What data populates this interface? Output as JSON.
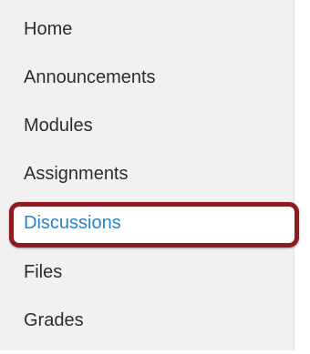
{
  "course_nav": {
    "items": [
      {
        "label": "Home",
        "active": false
      },
      {
        "label": "Announcements",
        "active": false
      },
      {
        "label": "Modules",
        "active": false
      },
      {
        "label": "Assignments",
        "active": false
      },
      {
        "label": "Discussions",
        "active": true
      },
      {
        "label": "Files",
        "active": false
      },
      {
        "label": "Grades",
        "active": false
      }
    ]
  },
  "colors": {
    "panel_background": "#f1f1f1",
    "text": "#2d2d2d",
    "active_link": "#2a83c4",
    "highlight_border": "#8e1a22"
  }
}
